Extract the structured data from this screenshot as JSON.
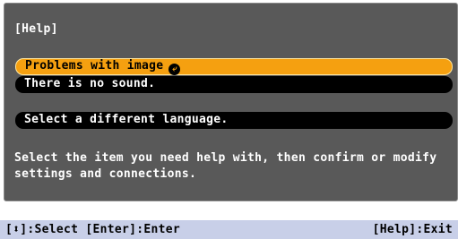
{
  "panel": {
    "title": "[Help]",
    "items": [
      {
        "label": "Problems with image",
        "selected": true,
        "has_enter_icon": true
      },
      {
        "label": "There is no sound.",
        "selected": false
      },
      {
        "label": "Select a different language.",
        "selected": false
      }
    ],
    "description_line1": "Select the item you need help with, then confirm or modify",
    "description_line2": "settings and connections."
  },
  "status_bar": {
    "left_text": "[⬍]:Select [Enter]:Enter",
    "right_text": "[Help]:Exit"
  },
  "icons": {
    "enter": "enter-return-icon",
    "updown": "up-down-arrow-icon"
  },
  "colors": {
    "panel_bg": "#595959",
    "selected_bg": "#f5a010",
    "item_bg": "#000000",
    "status_bg": "#c8cfe8"
  }
}
